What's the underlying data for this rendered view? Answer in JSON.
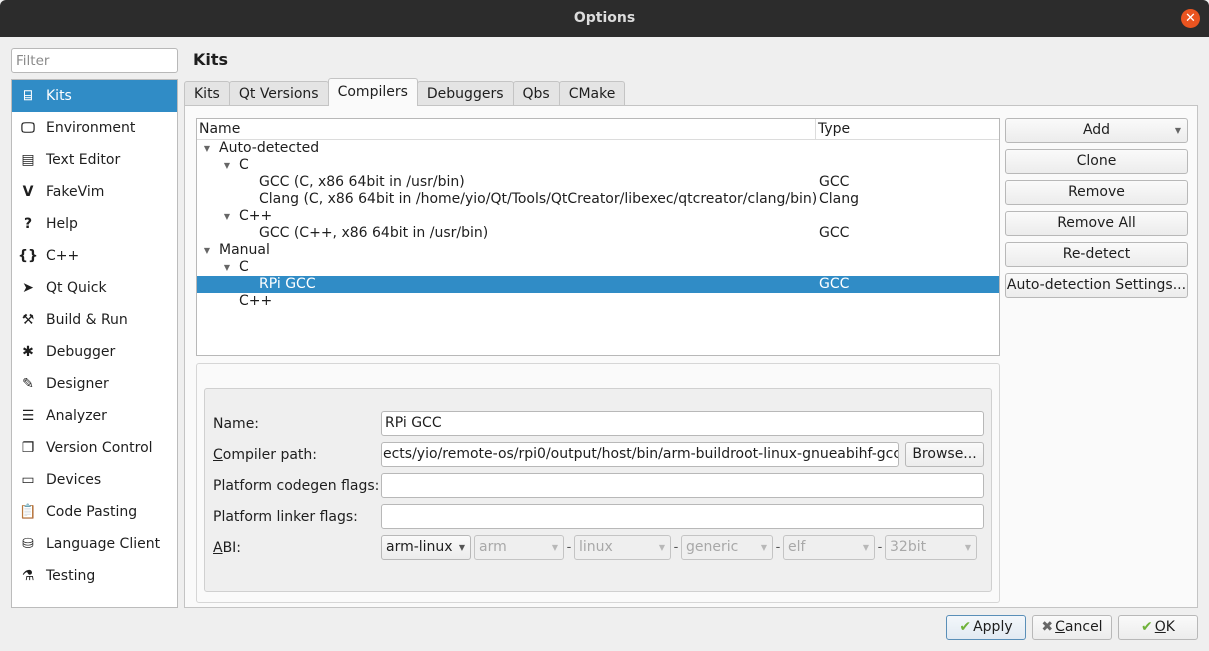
{
  "window": {
    "title": "Options",
    "close_icon": "close-icon"
  },
  "filter": {
    "placeholder": "Filter",
    "value": ""
  },
  "sidebar": {
    "items": [
      {
        "label": "Kits",
        "icon": "kits-icon",
        "glyph": "⌸",
        "active": true
      },
      {
        "label": "Environment",
        "icon": "monitor-icon",
        "glyph": "🖵"
      },
      {
        "label": "Text Editor",
        "icon": "text-editor-icon",
        "glyph": "▤"
      },
      {
        "label": "FakeVim",
        "icon": "fakevim-icon",
        "glyph": "V"
      },
      {
        "label": "Help",
        "icon": "help-icon",
        "glyph": "?"
      },
      {
        "label": "C++",
        "icon": "braces-icon",
        "glyph": "{}"
      },
      {
        "label": "Qt Quick",
        "icon": "qt-quick-icon",
        "glyph": "➤"
      },
      {
        "label": "Build & Run",
        "icon": "hammer-icon",
        "glyph": "⚒"
      },
      {
        "label": "Debugger",
        "icon": "bug-icon",
        "glyph": "✱"
      },
      {
        "label": "Designer",
        "icon": "pen-icon",
        "glyph": "✎"
      },
      {
        "label": "Analyzer",
        "icon": "analyzer-icon",
        "glyph": "☰"
      },
      {
        "label": "Version Control",
        "icon": "version-control-icon",
        "glyph": "❐"
      },
      {
        "label": "Devices",
        "icon": "devices-icon",
        "glyph": "▭"
      },
      {
        "label": "Code Pasting",
        "icon": "clipboard-icon",
        "glyph": "📋"
      },
      {
        "label": "Language Client",
        "icon": "language-client-icon",
        "glyph": "⛁"
      },
      {
        "label": "Testing",
        "icon": "flask-icon",
        "glyph": "⚗"
      }
    ]
  },
  "page": {
    "title": "Kits"
  },
  "tabs": [
    {
      "label": "Kits"
    },
    {
      "label": "Qt Versions"
    },
    {
      "label": "Compilers",
      "active": true
    },
    {
      "label": "Debuggers"
    },
    {
      "label": "Qbs"
    },
    {
      "label": "CMake"
    }
  ],
  "tree": {
    "columns": {
      "name": "Name",
      "type": "Type"
    },
    "rows": [
      {
        "level": 0,
        "expanded": true,
        "name": "Auto-detected",
        "type": ""
      },
      {
        "level": 1,
        "expanded": true,
        "name": "C",
        "type": ""
      },
      {
        "level": 2,
        "name": "GCC (C, x86 64bit in /usr/bin)",
        "type": "GCC"
      },
      {
        "level": 2,
        "name": "Clang (C, x86 64bit in /home/yio/Qt/Tools/QtCreator/libexec/qtcreator/clang/bin)",
        "type": "Clang"
      },
      {
        "level": 1,
        "expanded": true,
        "name": "C++",
        "type": ""
      },
      {
        "level": 2,
        "name": "GCC (C++, x86 64bit in /usr/bin)",
        "type": "GCC"
      },
      {
        "level": 0,
        "expanded": true,
        "name": "Manual",
        "type": ""
      },
      {
        "level": 1,
        "expanded": true,
        "name": "C",
        "type": ""
      },
      {
        "level": 2,
        "name": "RPi GCC",
        "type": "GCC",
        "selected": true
      },
      {
        "level": 1,
        "name": "C++",
        "type": ""
      }
    ]
  },
  "actions": {
    "add": "Add",
    "clone": "Clone",
    "remove": "Remove",
    "remove_all": "Remove All",
    "redetect": "Re-detect",
    "auto_detection_settings": "Auto-detection Settings..."
  },
  "form": {
    "name_label": "Name:",
    "name_value": "RPi GCC",
    "compiler_path_label_u": "C",
    "compiler_path_label_rest": "ompiler path:",
    "compiler_path_value": "ects/yio/remote-os/rpi0/output/host/bin/arm-buildroot-linux-gnueabihf-gcc",
    "browse": "Browse...",
    "codegen_label": "Platform codegen flags:",
    "codegen_value": "",
    "linker_label": "Platform linker flags:",
    "linker_value": "",
    "abi_label_u": "A",
    "abi_label_rest": "BI:",
    "abi": {
      "preset": "arm-linux",
      "architecture": "arm",
      "os": "linux",
      "flavor": "generic",
      "format": "elf",
      "width": "32bit",
      "separator": "-"
    }
  },
  "footer": {
    "apply": "Apply",
    "cancel_u": "C",
    "cancel_rest": "ancel",
    "ok_u": "O",
    "ok_rest": "K"
  },
  "colors": {
    "selection": "#308cc6",
    "close": "#e95420",
    "check": "#6fb23a"
  }
}
